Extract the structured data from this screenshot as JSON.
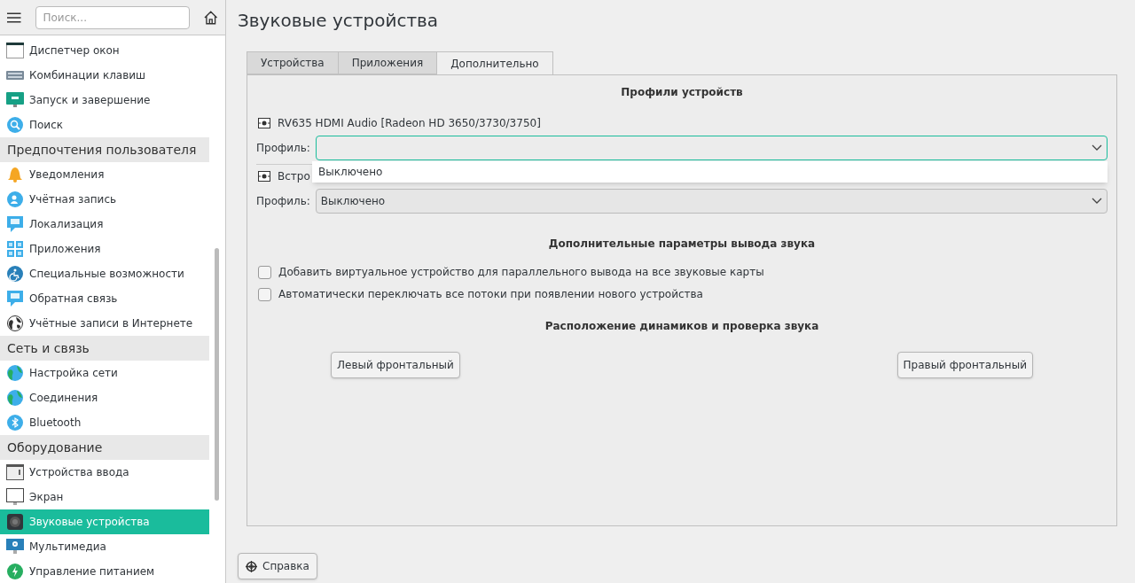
{
  "sidebar": {
    "search": {
      "placeholder": "Поиск..."
    },
    "items": [
      {
        "kind": "item",
        "label": "Диспетчер окон",
        "selected": false
      },
      {
        "kind": "item",
        "label": "Комбинации клавиш",
        "selected": false
      },
      {
        "kind": "item",
        "label": "Запуск и завершение",
        "selected": false
      },
      {
        "kind": "item",
        "label": "Поиск",
        "selected": false
      },
      {
        "kind": "category",
        "label": "Предпочтения пользователя"
      },
      {
        "kind": "item",
        "label": "Уведомления",
        "selected": false
      },
      {
        "kind": "item",
        "label": "Учётная запись",
        "selected": false
      },
      {
        "kind": "item",
        "label": "Локализация",
        "selected": false
      },
      {
        "kind": "item",
        "label": "Приложения",
        "selected": false
      },
      {
        "kind": "item",
        "label": "Специальные возможности",
        "selected": false
      },
      {
        "kind": "item",
        "label": "Обратная связь",
        "selected": false
      },
      {
        "kind": "item",
        "label": "Учётные записи в Интернете",
        "selected": false
      },
      {
        "kind": "category",
        "label": "Сеть и связь"
      },
      {
        "kind": "item",
        "label": "Настройка сети",
        "selected": false
      },
      {
        "kind": "item",
        "label": "Соединения",
        "selected": false
      },
      {
        "kind": "item",
        "label": "Bluetooth",
        "selected": false
      },
      {
        "kind": "category",
        "label": "Оборудование"
      },
      {
        "kind": "item",
        "label": "Устройства ввода",
        "selected": false
      },
      {
        "kind": "item",
        "label": "Экран",
        "selected": false
      },
      {
        "kind": "item",
        "label": "Звуковые устройства",
        "selected": true
      },
      {
        "kind": "item",
        "label": "Мультимедиа",
        "selected": false
      },
      {
        "kind": "item",
        "label": "Управление питанием",
        "selected": false
      }
    ]
  },
  "page": {
    "title": "Звуковые устройства",
    "tabs": [
      {
        "label": "Устройства",
        "selected": false
      },
      {
        "label": "Приложения",
        "selected": false
      },
      {
        "label": "Дополнительно",
        "selected": true
      }
    ],
    "profiles_heading": "Профили устройств",
    "devices": [
      {
        "name": "RV635 HDMI Audio [Radeon HD 3650/3730/3750]",
        "profile_label": "Профиль:",
        "expanded": true,
        "options": [
          "Выключено"
        ]
      },
      {
        "name": "Встро",
        "profile_label": "Профиль:",
        "value": "Выключено",
        "expanded": false
      }
    ],
    "output_heading": "Дополнительные параметры вывода звука",
    "checkboxes": [
      {
        "label": "Добавить виртуальное устройство для параллельного вывода на все звуковые карты",
        "checked": false
      },
      {
        "label": "Автоматически переключать все потоки при появлении нового устройства",
        "checked": false
      }
    ],
    "speakers_heading": "Расположение динамиков и проверка звука",
    "speakers": [
      "Левый фронтальный",
      "Правый фронтальный"
    ],
    "help_button": "Справка"
  }
}
